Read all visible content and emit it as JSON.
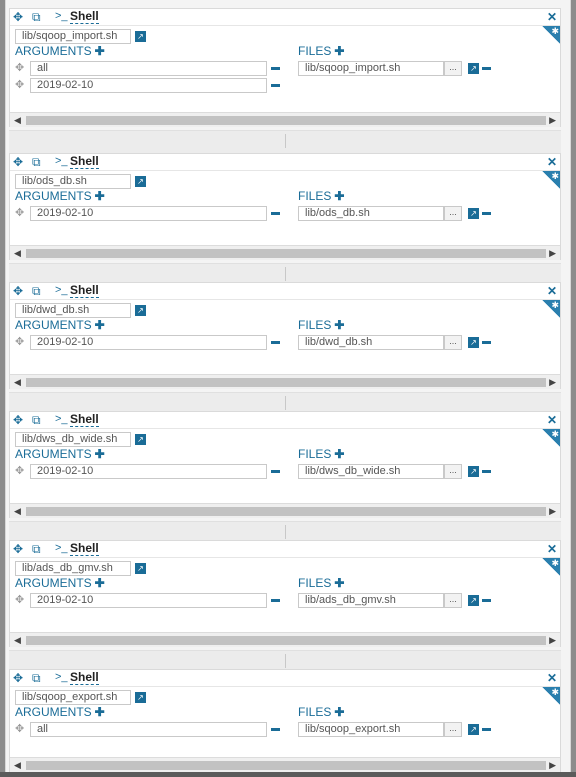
{
  "actions": [
    {
      "title": "Shell",
      "prompt": ">_",
      "script": "lib/sqoop_import.sh",
      "arguments_label": "ARGUMENTS",
      "files_label": "FILES",
      "args": [
        "all",
        "2019-02-10"
      ],
      "file": "lib/sqoop_import.sh",
      "dots": "..."
    },
    {
      "title": "Shell",
      "prompt": ">_",
      "script": "lib/ods_db.sh",
      "arguments_label": "ARGUMENTS",
      "files_label": "FILES",
      "args": [
        "2019-02-10"
      ],
      "file": "lib/ods_db.sh",
      "dots": "..."
    },
    {
      "title": "Shell",
      "prompt": ">_",
      "script": "lib/dwd_db.sh",
      "arguments_label": "ARGUMENTS",
      "files_label": "FILES",
      "args": [
        "2019-02-10"
      ],
      "file": "lib/dwd_db.sh",
      "dots": "..."
    },
    {
      "title": "Shell",
      "prompt": ">_",
      "script": "lib/dws_db_wide.sh",
      "arguments_label": "ARGUMENTS",
      "files_label": "FILES",
      "args": [
        "2019-02-10"
      ],
      "file": "lib/dws_db_wide.sh",
      "dots": "..."
    },
    {
      "title": "Shell",
      "prompt": ">_",
      "script": "lib/ads_db_gmv.sh",
      "arguments_label": "ARGUMENTS",
      "files_label": "FILES",
      "args": [
        "2019-02-10"
      ],
      "file": "lib/ads_db_gmv.sh",
      "dots": "..."
    },
    {
      "title": "Shell",
      "prompt": ">_",
      "script": "lib/sqoop_export.sh",
      "arguments_label": "ARGUMENTS",
      "files_label": "FILES",
      "args": [
        "all"
      ],
      "file": "lib/sqoop_export.sh",
      "dots": "..."
    }
  ],
  "icons": {
    "move": "move-icon",
    "copy": "copy-icon",
    "close": "close-icon",
    "gear": "gear-icon",
    "external": "external-link-icon",
    "drag": "drag-handle-icon",
    "remove": "remove-icon"
  },
  "colors": {
    "accent": "#1a6c97",
    "panel_bg": "#ffffff",
    "page_bg": "#f4f4f4"
  }
}
